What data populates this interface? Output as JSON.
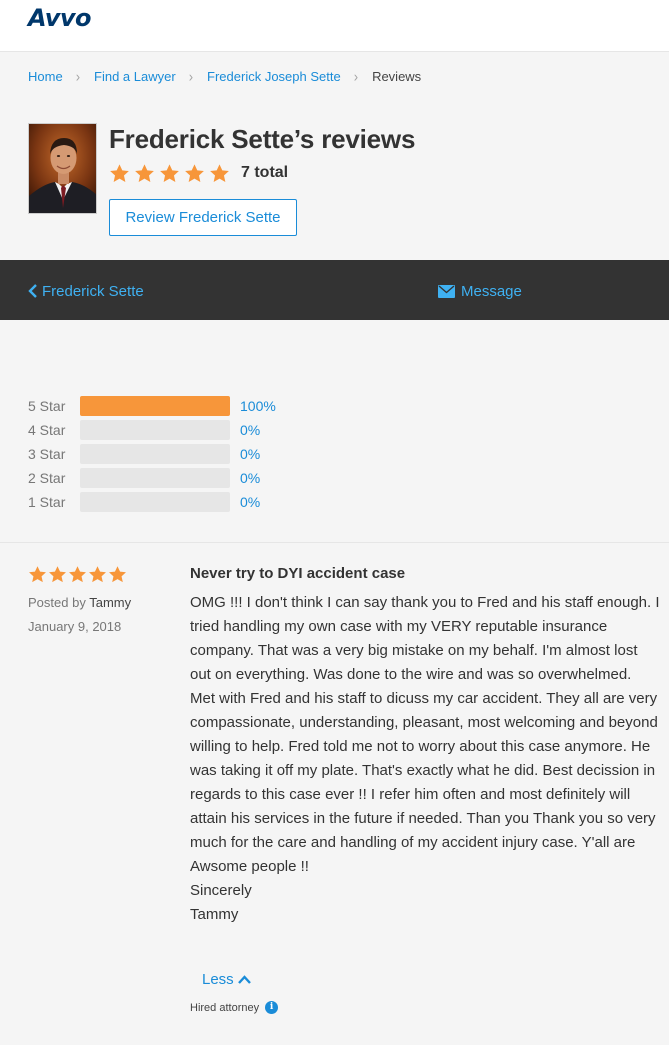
{
  "brand": {
    "logo_text": "Avvo",
    "logo_color": "#00376b"
  },
  "breadcrumb": {
    "items": [
      "Home",
      "Find a Lawyer",
      "Frederick Joseph Sette"
    ],
    "current": "Reviews"
  },
  "profile": {
    "title": "Frederick Sette’s reviews",
    "rating_stars": 5,
    "total_label": "7 total",
    "review_button_label": "Review Frederick Sette"
  },
  "actionbar": {
    "back_label": "Frederick Sette",
    "message_label": "Message"
  },
  "distribution": [
    {
      "label": "5 Star",
      "pct": 100,
      "pct_label": "100%"
    },
    {
      "label": "4 Star",
      "pct": 0,
      "pct_label": "0%"
    },
    {
      "label": "3 Star",
      "pct": 0,
      "pct_label": "0%"
    },
    {
      "label": "2 Star",
      "pct": 0,
      "pct_label": "0%"
    },
    {
      "label": "1 Star",
      "pct": 0,
      "pct_label": "0%"
    }
  ],
  "review": {
    "stars": 5,
    "posted_by_prefix": "Posted by",
    "author": "Tammy",
    "date": "January 9, 2018",
    "title": "Never try to DYI accident case",
    "body": "OMG !!! I don't think I can say thank you to Fred and his staff enough. I tried handling my own case with my VERY reputable insurance company. That was a very big mistake on my behalf. I'm almost lost out on everything. Was done to the wire and was so overwhelmed. Met with Fred and his staff to dicuss my car accident. They all are very compassionate, understanding, pleasant, most welcoming and beyond willing to help. Fred told me not to worry about this case anymore. He was taking it off my plate. That's exactly what he did. Best decission in regards to this case ever !! I refer him often and most definitely will attain his services in the future if needed. Than you Thank you so very much for the care and handling of my accident injury case. Y'all are Awsome people !!",
    "closing": "Sincerely",
    "signature": "Tammy",
    "less_label": "Less",
    "hired_label": "Hired attorney"
  },
  "colors": {
    "accent_blue": "#1a8cd8",
    "star_orange": "#f7963a",
    "dark_bar": "#333333",
    "bar_link": "#3fb1f2"
  },
  "icons": [
    "star-icon",
    "chevron-left-icon",
    "envelope-icon",
    "chevron-up-icon",
    "info-icon",
    "breadcrumb-chevron-icon"
  ]
}
